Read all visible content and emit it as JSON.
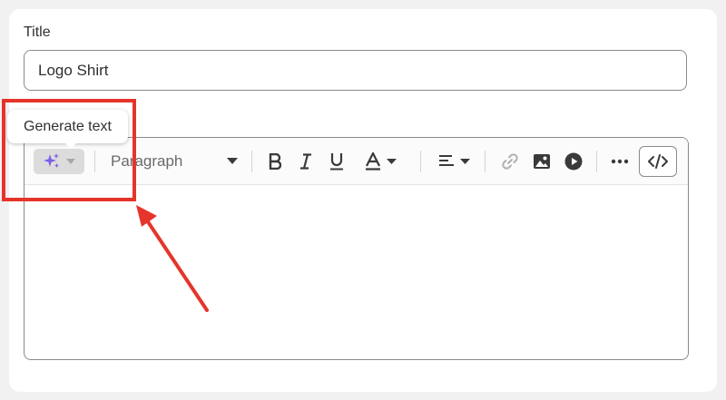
{
  "title_field": {
    "label": "Title",
    "value": "Logo Shirt"
  },
  "description_field": {
    "label": ""
  },
  "tooltip": {
    "text": "Generate text"
  },
  "toolbar": {
    "paragraph_label": "Paragraph",
    "icons": [
      "sparkles-icon",
      "chevron-down-icon",
      "bold-icon",
      "italic-icon",
      "underline-icon",
      "text-color-icon",
      "align-icon",
      "link-icon",
      "image-icon",
      "video-icon",
      "more-icon",
      "code-icon"
    ]
  },
  "colors": {
    "highlight": "#e5352b",
    "sparkle": "#7c5ce8"
  }
}
